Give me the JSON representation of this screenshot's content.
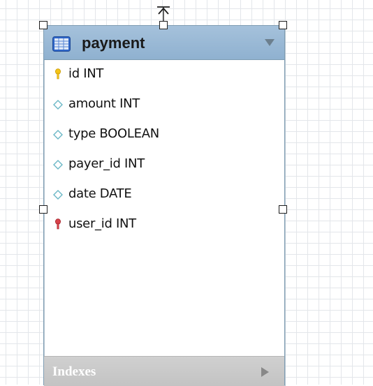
{
  "entity": {
    "name": "payment",
    "columns": [
      {
        "label": "id INT",
        "key_type": "primary",
        "icon": "primary-key-icon",
        "icon_color": "#f5c518"
      },
      {
        "label": "amount INT",
        "key_type": "none",
        "icon": "column-diamond-icon",
        "icon_color": "#7fc4cf"
      },
      {
        "label": "type BOOLEAN",
        "key_type": "none",
        "icon": "column-diamond-icon",
        "icon_color": "#7fc4cf"
      },
      {
        "label": "payer_id INT",
        "key_type": "none",
        "icon": "column-diamond-icon",
        "icon_color": "#7fc4cf"
      },
      {
        "label": "date DATE",
        "key_type": "none",
        "icon": "column-diamond-icon",
        "icon_color": "#7fc4cf"
      },
      {
        "label": "user_id INT",
        "key_type": "foreign",
        "icon": "foreign-key-icon",
        "icon_color": "#d9434b"
      }
    ],
    "indexes_label": "Indexes"
  },
  "colors": {
    "header": "#9dbbd8",
    "border": "#7f9db3",
    "indexes_bar": "#c8c8c8"
  }
}
